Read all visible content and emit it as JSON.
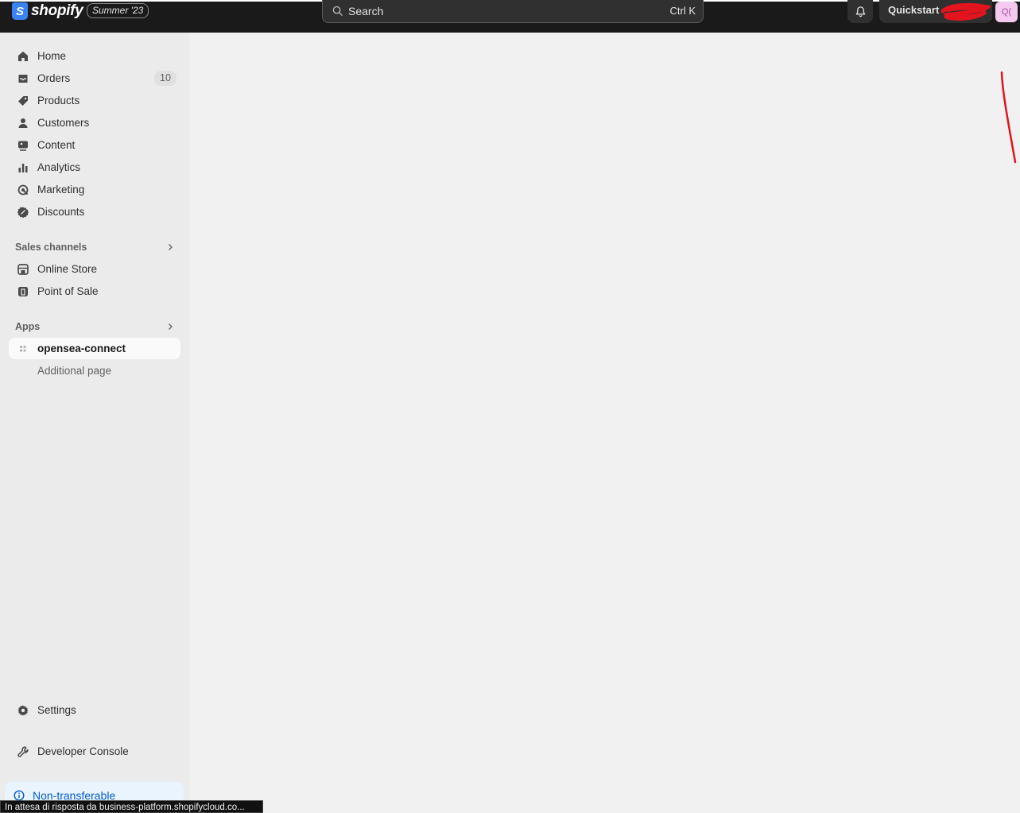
{
  "topbar": {
    "logo_text": "shopify",
    "logo_letter": "S",
    "edition_badge": "Summer '23",
    "search": {
      "placeholder": "Search",
      "shortcut": "Ctrl K"
    },
    "store_button_label": "Quickstart",
    "avatar_text": "Q("
  },
  "sidebar": {
    "main_items": [
      {
        "label": "Home",
        "icon": "home-icon"
      },
      {
        "label": "Orders",
        "icon": "orders-icon",
        "badge": "10"
      },
      {
        "label": "Products",
        "icon": "tag-icon"
      },
      {
        "label": "Customers",
        "icon": "person-icon"
      },
      {
        "label": "Content",
        "icon": "content-icon"
      },
      {
        "label": "Analytics",
        "icon": "bar-chart-icon"
      },
      {
        "label": "Marketing",
        "icon": "target-icon"
      },
      {
        "label": "Discounts",
        "icon": "discount-icon"
      }
    ],
    "sales_channels": {
      "header": "Sales channels",
      "items": [
        {
          "label": "Online Store",
          "icon": "storefront-icon"
        },
        {
          "label": "Point of Sale",
          "icon": "pos-icon"
        }
      ]
    },
    "apps": {
      "header": "Apps",
      "items": [
        {
          "label": "opensea-connect",
          "icon": "app-grid-icon",
          "active": true
        },
        {
          "label": "Additional page"
        }
      ]
    },
    "settings_label": "Settings",
    "developer_console_label": "Developer Console",
    "banner_label": "Non-transferable"
  },
  "statusbar": {
    "text": "In attesa di risposta da business-platform.shopifycloud.co..."
  },
  "colors": {
    "topbar": "#1a1a1a",
    "sidebar": "#ebebeb",
    "main": "#f1f1f1",
    "logo_blue": "#3b82f6",
    "banner_text": "#005bd3",
    "annotation_red": "#e3141e"
  }
}
